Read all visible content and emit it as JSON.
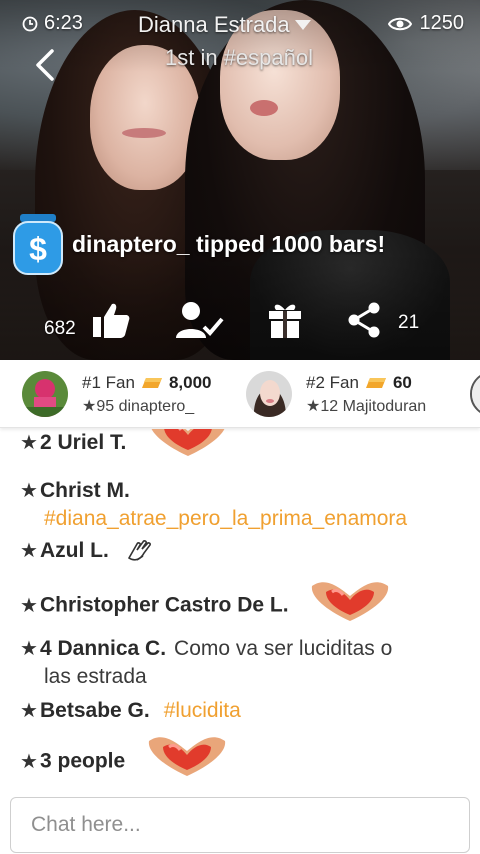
{
  "header": {
    "time": "6:23",
    "streamer_name": "Dianna Estrada",
    "rank": "1st in #español",
    "viewer_count": "1250"
  },
  "tip_banner": {
    "text": "dinaptero_ tipped 1000 bars!"
  },
  "actions": {
    "likes": "682",
    "shares": "21"
  },
  "fans": [
    {
      "rank_label": "#1 Fan",
      "bars": "8,000",
      "level_user": "★95 dinaptero_"
    },
    {
      "rank_label": "#2 Fan",
      "bars": "60",
      "level_user": "★12 Majitoduran"
    }
  ],
  "chat": [
    {
      "star": "★",
      "user": "2 Uriel T.",
      "text": "",
      "tag": "",
      "sticker": "heart-hands"
    },
    {
      "star": "★",
      "user": "Christ M.",
      "text": "",
      "tag": "#diana_atrae_pero_la_prima_enamora",
      "sticker": ""
    },
    {
      "star": "★",
      "user": "Azul L.",
      "text": "",
      "tag": "",
      "sticker": "clap-hands"
    },
    {
      "star": "★",
      "user": "Christopher Castro De L.",
      "text": "",
      "tag": "",
      "sticker": "heart-hands"
    },
    {
      "star": "★",
      "user": "4 Dannica C.",
      "text": "Como va ser luciditas o",
      "text2": "las estrada",
      "tag": "",
      "sticker": ""
    },
    {
      "star": "★",
      "user": "Betsabe G.",
      "text": "",
      "tag": "#lucidita",
      "sticker": ""
    },
    {
      "star": "★",
      "user": "3 people",
      "text": "",
      "tag": "",
      "sticker": "heart-hands"
    }
  ],
  "input": {
    "placeholder": "Chat here..."
  },
  "colors": {
    "accent": "#f0a030",
    "tip_icon": "#2e9be6",
    "text_dark": "#222222"
  }
}
